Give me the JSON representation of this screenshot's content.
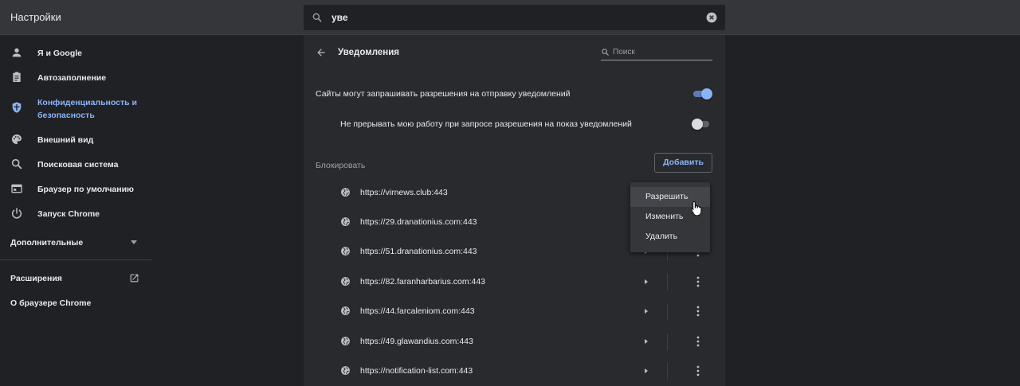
{
  "header": {
    "title": "Настройки",
    "search_value": "уве"
  },
  "sidebar": {
    "items": [
      {
        "label": "Я и Google",
        "icon": "person-icon"
      },
      {
        "label": "Автозаполнение",
        "icon": "clipboard-icon"
      },
      {
        "label": "Конфиденциальность и безопасность",
        "icon": "shield-icon",
        "active": true
      },
      {
        "label": "Внешний вид",
        "icon": "palette-icon"
      },
      {
        "label": "Поисковая система",
        "icon": "search-icon"
      },
      {
        "label": "Браузер по умолчанию",
        "icon": "browser-icon"
      },
      {
        "label": "Запуск Chrome",
        "icon": "power-icon"
      }
    ],
    "advanced_label": "Дополнительные",
    "extensions_label": "Расширения",
    "about_label": "О браузере Chrome"
  },
  "panel": {
    "title": "Уведомления",
    "search_placeholder": "Поиск",
    "setting_ask": "Сайты могут запрашивать разрешения на отправку уведомлений",
    "setting_quiet": "Не прерывать мою работу при запросе разрешения на показ уведомлений",
    "block_label": "Блокировать",
    "add_label": "Добавить",
    "sites": [
      "https://virnews.club:443",
      "https://29.dranationius.com:443",
      "https://51.dranationius.com:443",
      "https://82.faranharbarius.com:443",
      "https://44.farcaleniom.com:443",
      "https://49.glawandius.com:443",
      "https://notification-list.com:443"
    ]
  },
  "context_menu": {
    "allow": "Разрешить",
    "edit": "Изменить",
    "remove": "Удалить"
  },
  "colors": {
    "accent": "#8ab4f8",
    "background": "#202124",
    "panel": "#292a2d"
  }
}
